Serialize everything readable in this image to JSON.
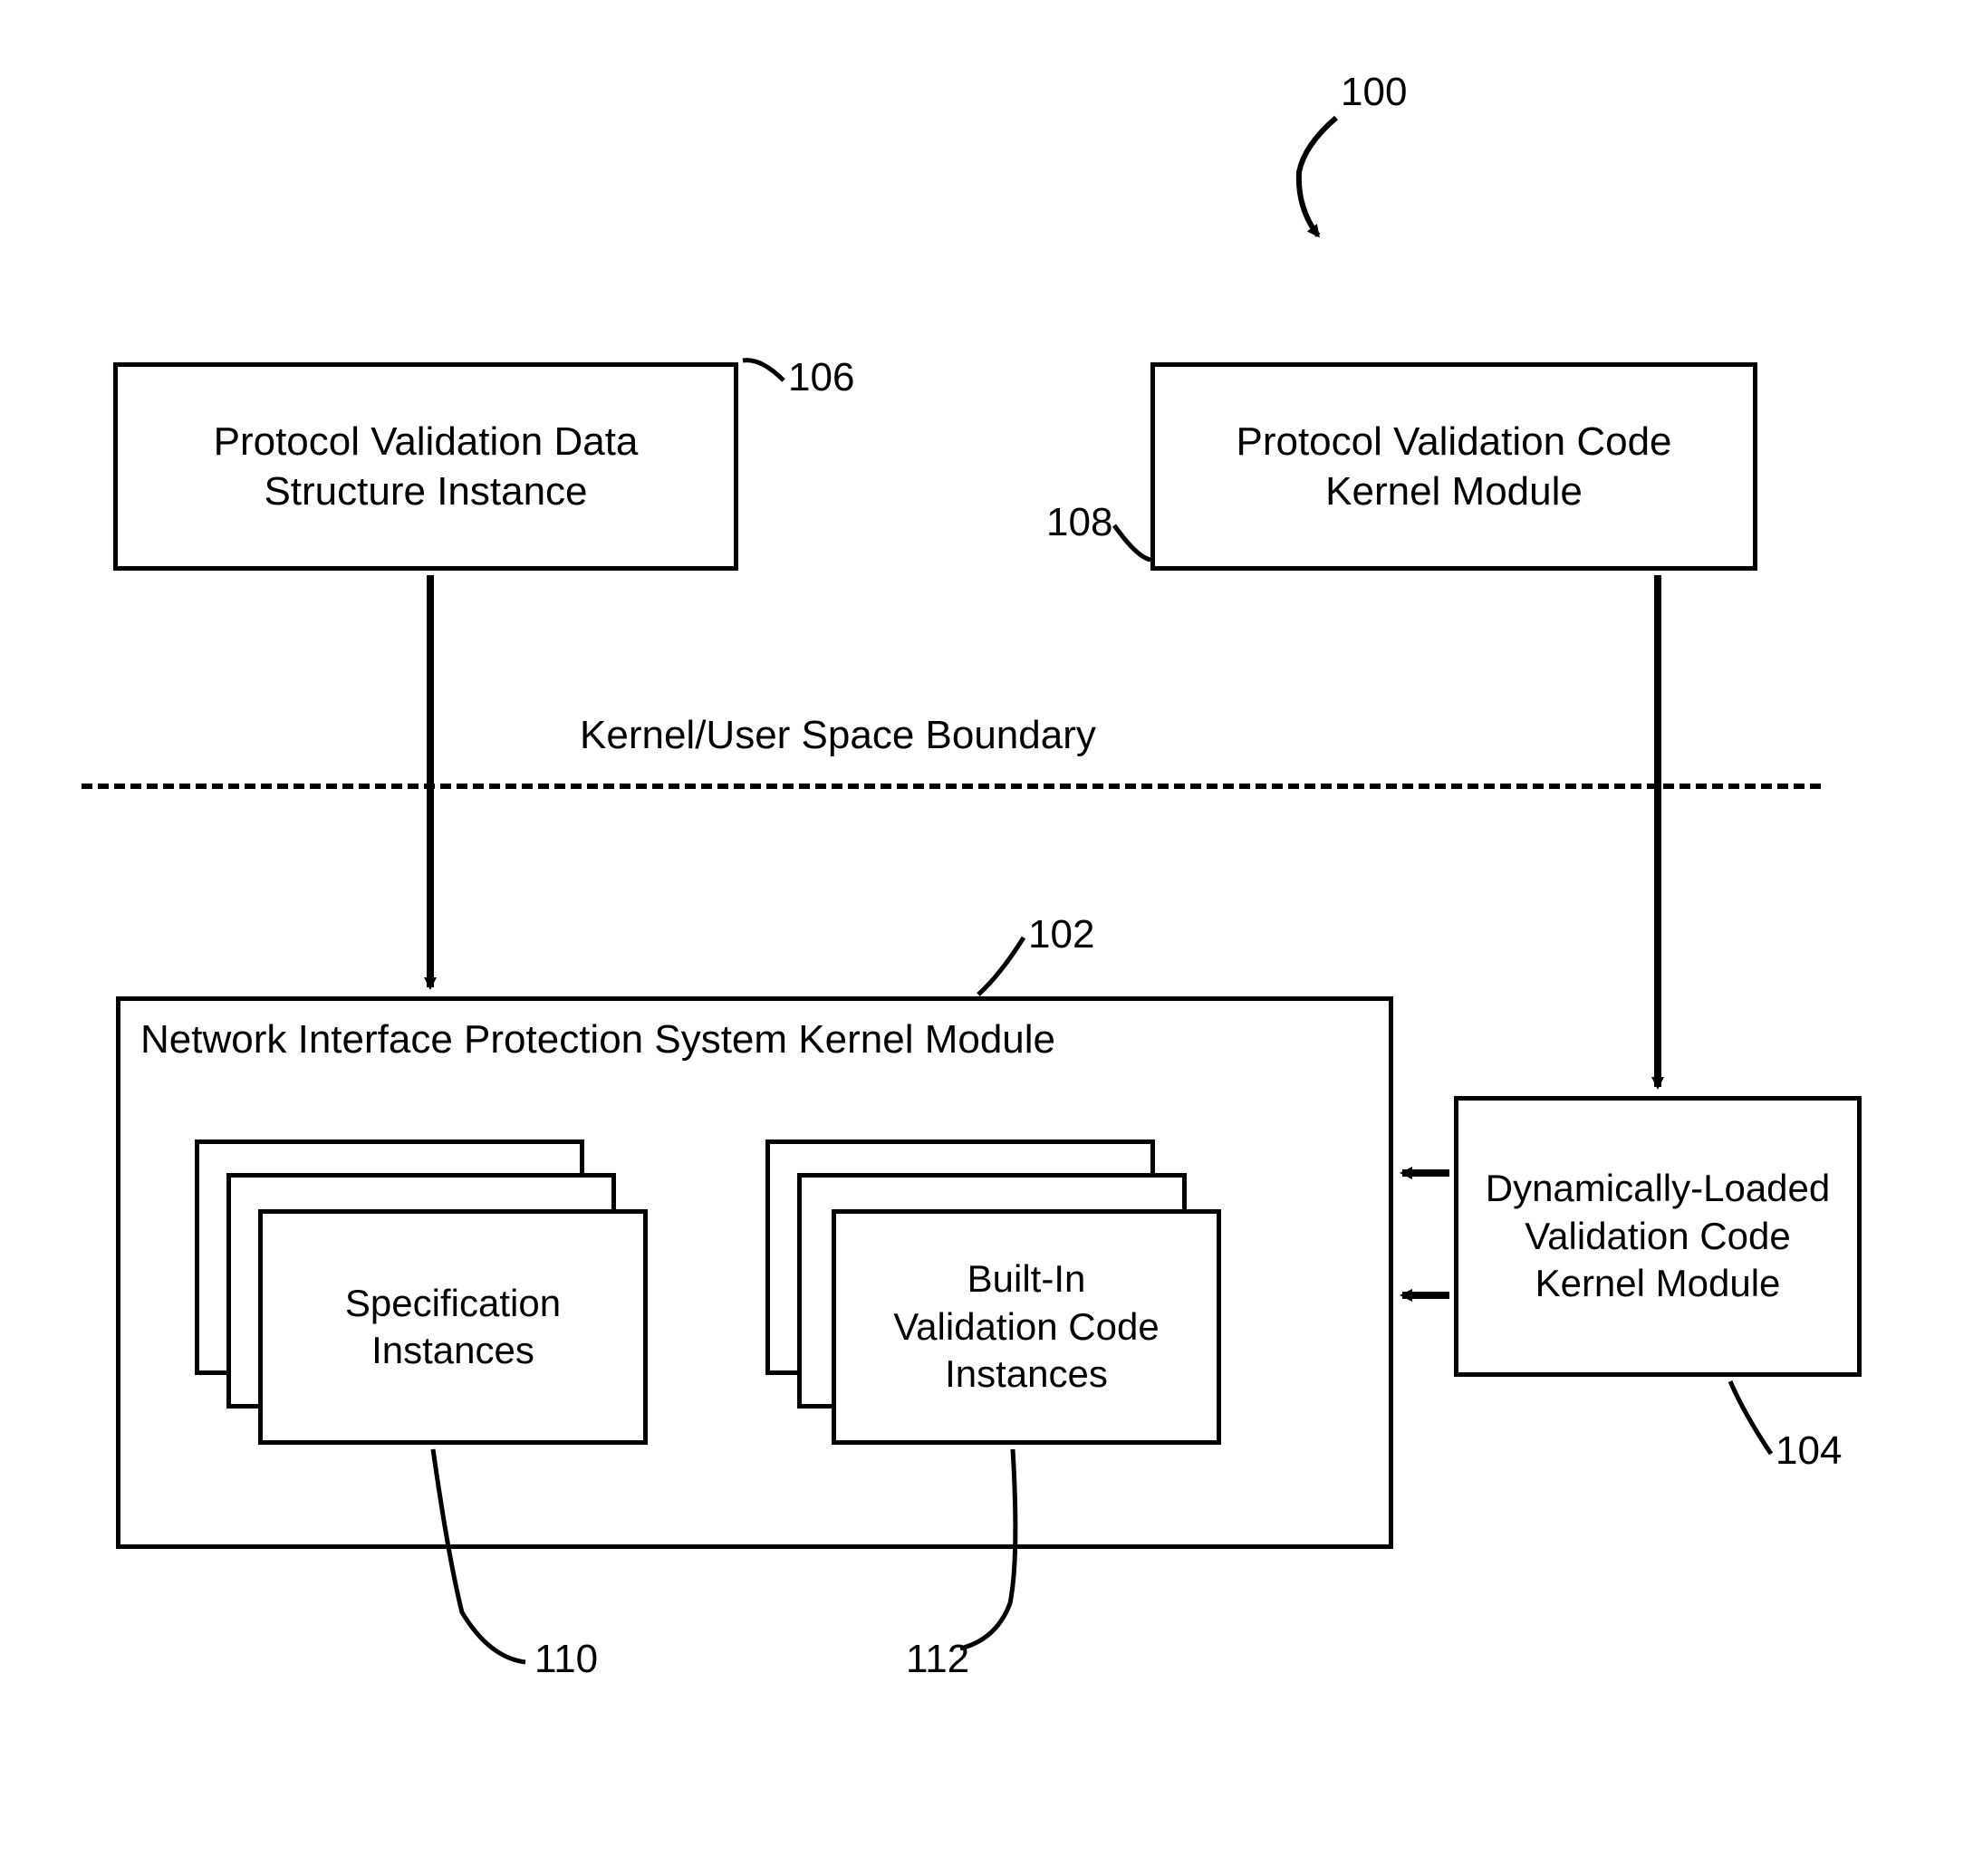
{
  "refs": {
    "overall": "100",
    "nips": "102",
    "dynModule": "104",
    "pvDataStruct": "106",
    "pvCodeModule": "108",
    "specInstances": "110",
    "builtInInstances": "112"
  },
  "boundaryLabel": "Kernel/User Space Boundary",
  "boxes": {
    "pvDataStruct": "Protocol Validation Data\nStructure Instance",
    "pvCodeModule": "Protocol Validation Code\nKernel Module",
    "nipsTitle": "Network Interface Protection System Kernel Module",
    "specInstances": "Specification\nInstances",
    "builtInInstances": "Built-In\nValidation Code\nInstances",
    "dynModule": "Dynamically-Loaded\nValidation Code\nKernel Module"
  }
}
